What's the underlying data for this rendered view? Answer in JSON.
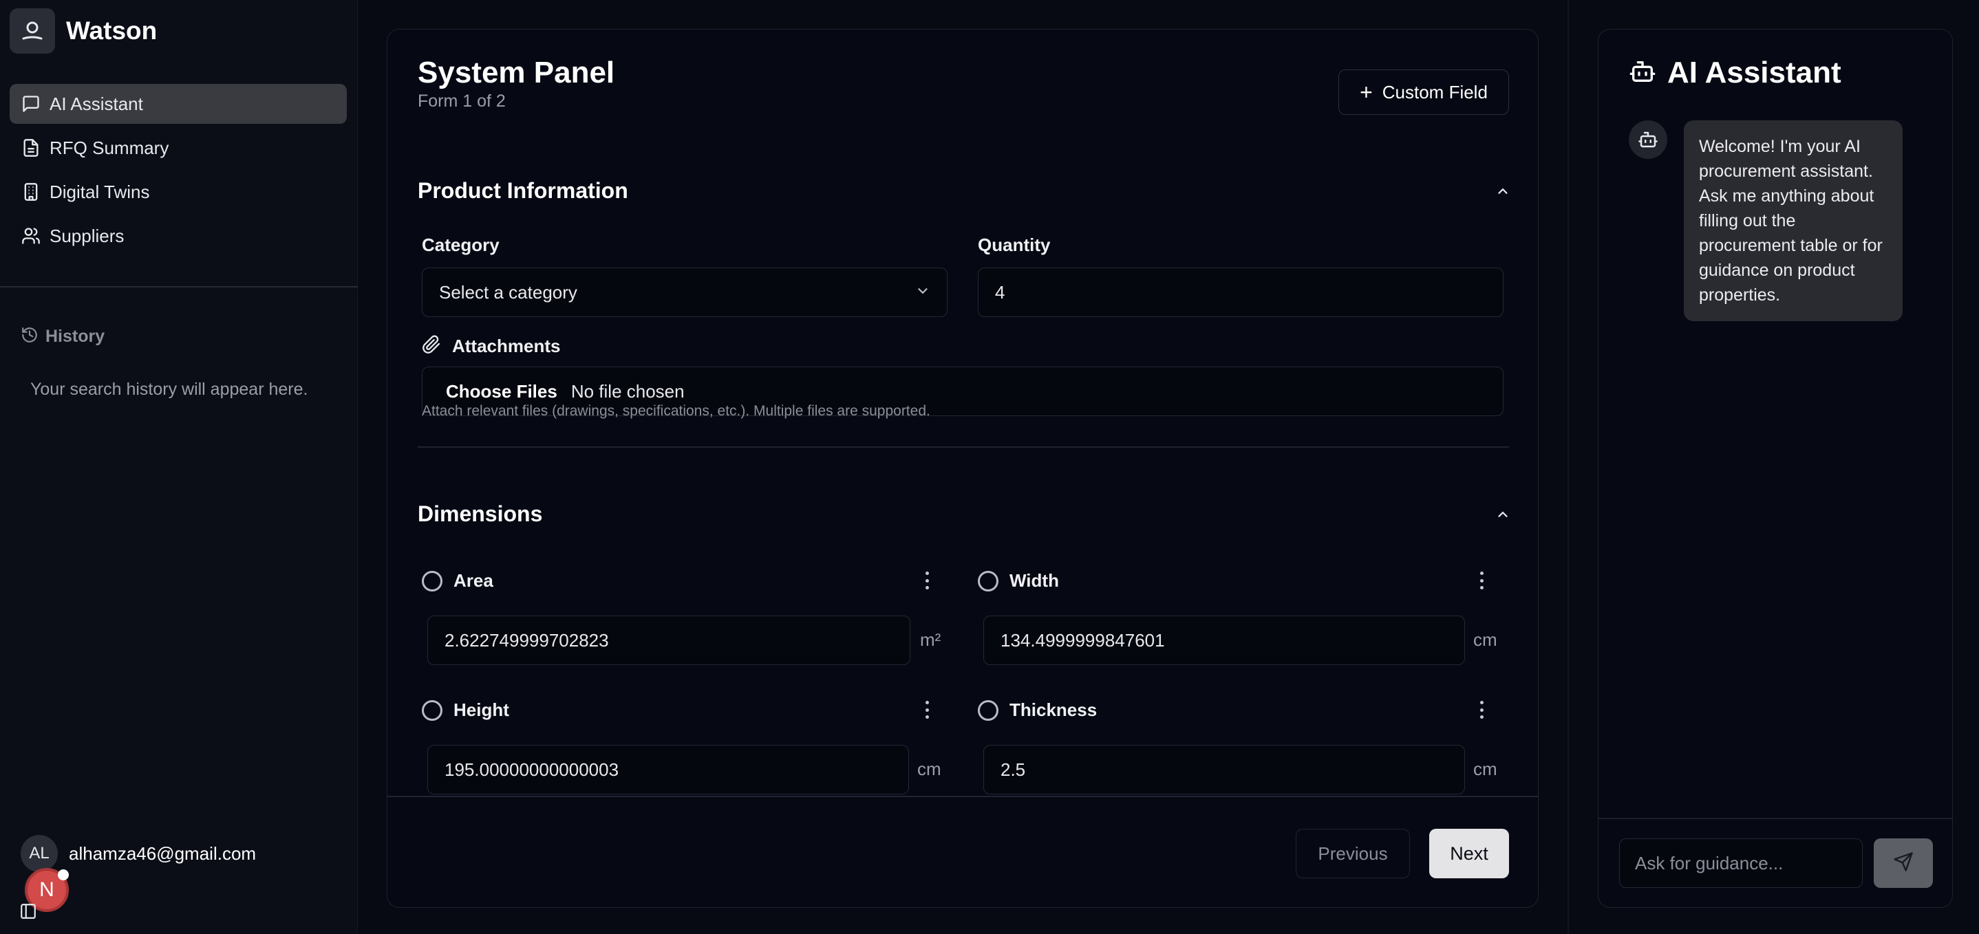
{
  "app": {
    "name": "Watson"
  },
  "sidebar": {
    "items": [
      {
        "label": "AI Assistant",
        "icon": "message-square-icon",
        "active": true
      },
      {
        "label": "RFQ Summary",
        "icon": "file-text-icon"
      },
      {
        "label": "Digital Twins",
        "icon": "building-icon"
      },
      {
        "label": "Suppliers",
        "icon": "users-icon"
      }
    ],
    "history_title": "History",
    "history_empty": "Your search history will appear here.",
    "user": {
      "initials": "AL",
      "email": "alhamza46@gmail.com"
    },
    "badge": "N"
  },
  "panel": {
    "title": "System Panel",
    "subtitle": "Form 1 of 2",
    "custom_field_label": "Custom Field",
    "product_section": {
      "title": "Product Information",
      "category_label": "Category",
      "category_value": "Select a category",
      "quantity_label": "Quantity",
      "quantity_value": "4",
      "attachments_label": "Attachments",
      "choose_files": "Choose Files",
      "no_file": "No file chosen",
      "hint": "Attach relevant files (drawings, specifications, etc.). Multiple files are supported."
    },
    "dimensions_section": {
      "title": "Dimensions",
      "fields": [
        {
          "label": "Area",
          "value": "2.622749999702823",
          "unit": "m²"
        },
        {
          "label": "Width",
          "value": "134.4999999847601",
          "unit": "cm"
        },
        {
          "label": "Height",
          "value": "195.00000000000003",
          "unit": "cm"
        },
        {
          "label": "Thickness",
          "value": "2.5",
          "unit": "cm"
        }
      ]
    },
    "previous_label": "Previous",
    "next_label": "Next"
  },
  "assistant": {
    "title": "AI Assistant",
    "welcome": "Welcome! I'm your AI procurement assistant. Ask me anything about filling out the procurement table or for guidance on product properties.",
    "input_placeholder": "Ask for guidance..."
  }
}
